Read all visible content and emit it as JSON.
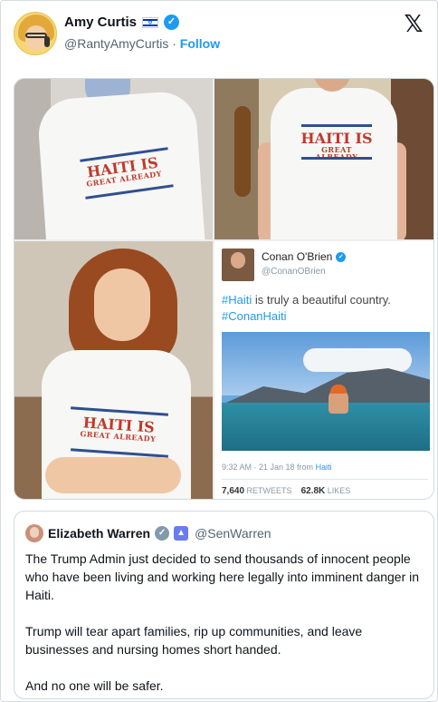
{
  "author": {
    "display_name": "Amy Curtis",
    "flag_icon": "israel-flag-icon",
    "verified_icon": "verified-badge-icon",
    "handle": "@RantyAmyCurtis",
    "separator": "·",
    "follow_label": "Follow"
  },
  "platform": {
    "logo_icon": "x-logo-icon",
    "logo_glyph": "𝕏"
  },
  "media": {
    "shirt_line1": "HAITI IS",
    "shirt_line2": "GREAT ALREADY",
    "embedded_tweet": {
      "name": "Conan O'Brien",
      "verified_glyph": "✓",
      "handle": "@ConanOBrien",
      "text_hashtag1": "#Haiti",
      "text_middle": " is truly a beautiful country.",
      "text_hashtag2": "#ConanHaiti",
      "timestamp": "9:32 AM · 21 Jan 18 from",
      "source": "Haiti",
      "retweets": "7,640",
      "retweets_label": "RETWEETS",
      "likes": "62.8K",
      "likes_label": "LIKES"
    }
  },
  "quoted": {
    "name": "Elizabeth Warren",
    "verified_glyph": "✓",
    "gov_glyph": "▲",
    "handle": "@SenWarren",
    "paragraphs": [
      "The Trump Admin just decided to send thousands of innocent people who have been living and working here legally into imminent danger in Haiti.",
      "Trump will tear apart families, rip up communities, and leave businesses and nursing homes short handed.",
      "And no one will be safer."
    ]
  },
  "colors": {
    "accent": "#1d9bf0",
    "text": "#0f1419",
    "muted": "#536471",
    "shirt_text": "#c0392b",
    "shirt_stripe": "#2f4f8f"
  }
}
